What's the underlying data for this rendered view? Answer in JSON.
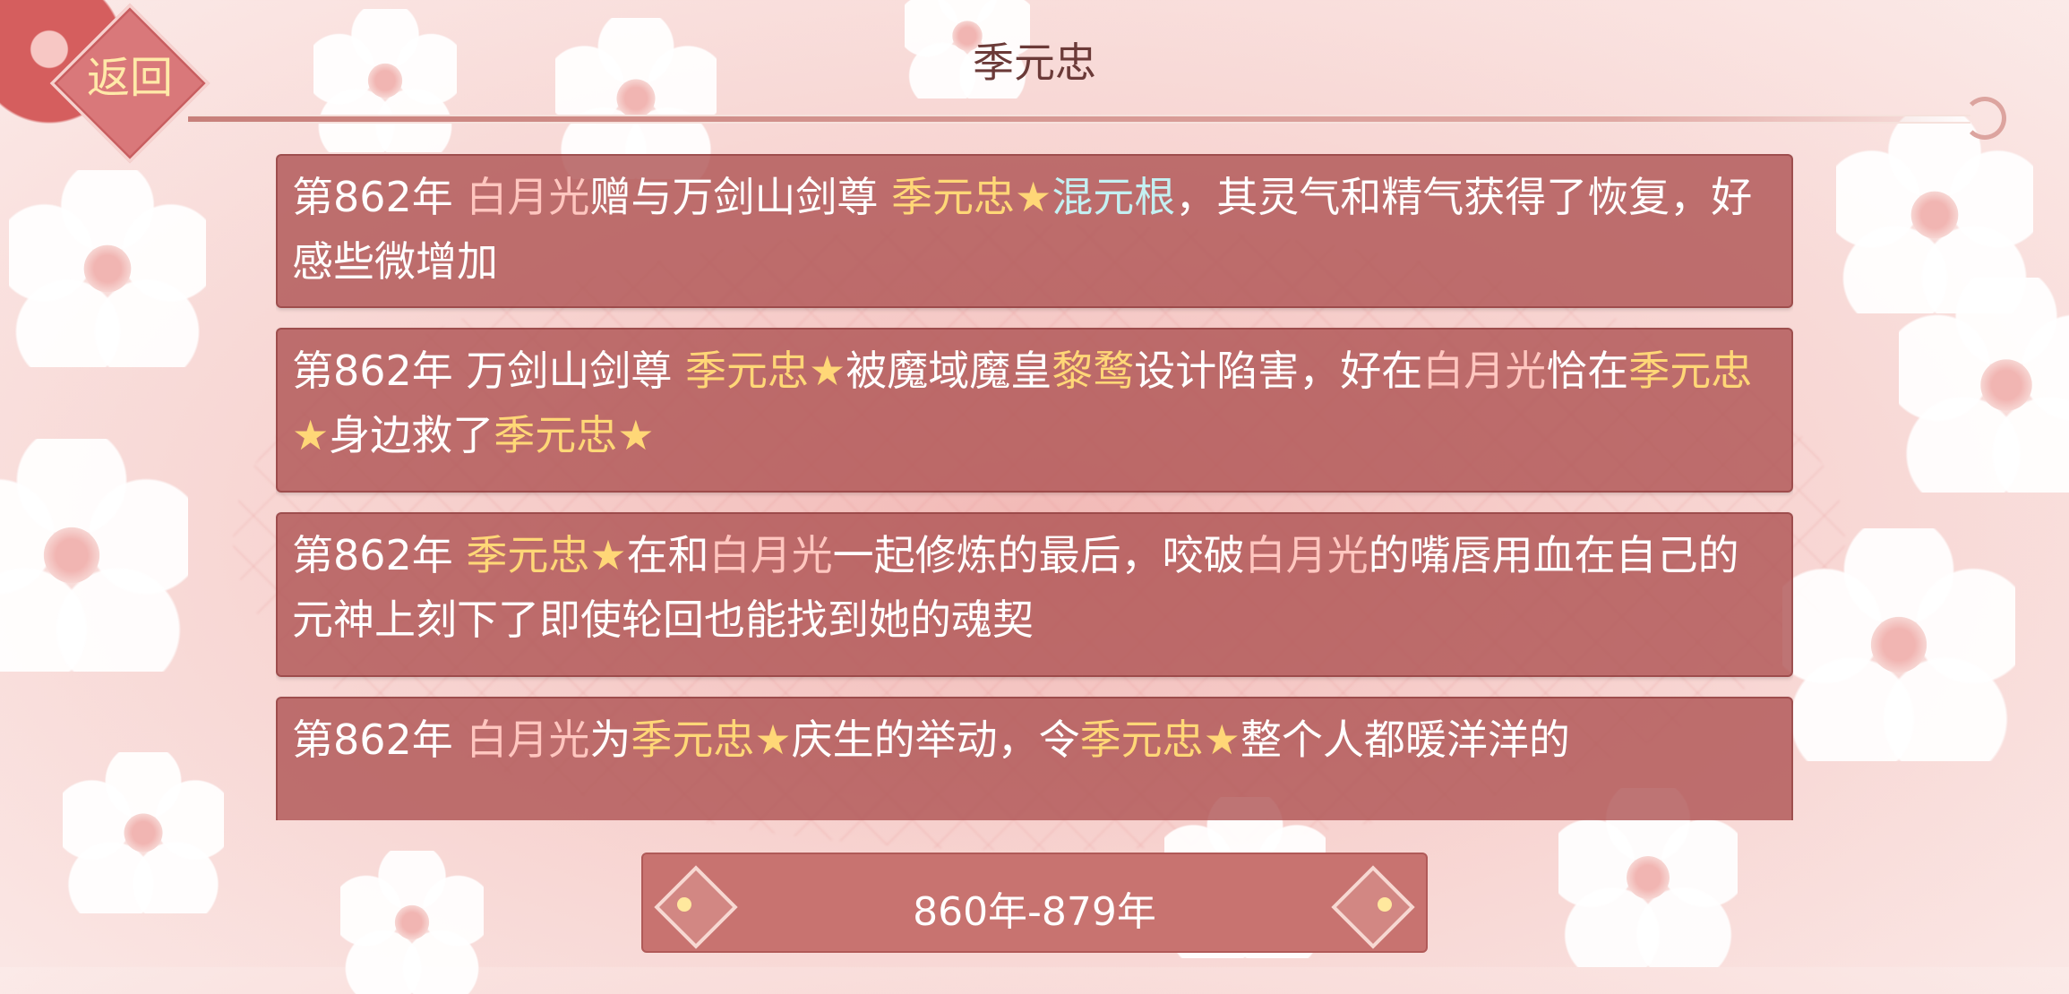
{
  "header": {
    "back_label": "返回",
    "title": "季元忠"
  },
  "entries": [
    {
      "parts": [
        {
          "t": "第862年 ",
          "c": "w"
        },
        {
          "t": "白月光",
          "c": "p"
        },
        {
          "t": "赠与万剑山剑尊 ",
          "c": "w"
        },
        {
          "t": "季元忠★",
          "c": "y"
        },
        {
          "t": "混元根",
          "c": "c"
        },
        {
          "t": "，其灵气和精气获得了恢复，好感些微增加",
          "c": "w"
        }
      ]
    },
    {
      "parts": [
        {
          "t": "第862年 万剑山剑尊 ",
          "c": "w"
        },
        {
          "t": "季元忠★",
          "c": "y"
        },
        {
          "t": "被魔域魔皇",
          "c": "w"
        },
        {
          "t": "黎鹜",
          "c": "y"
        },
        {
          "t": "设计陷害，好在",
          "c": "w"
        },
        {
          "t": "白月光",
          "c": "p"
        },
        {
          "t": "恰在",
          "c": "w"
        },
        {
          "t": "季元忠★",
          "c": "y"
        },
        {
          "t": "身边救了",
          "c": "w"
        },
        {
          "t": "季元忠★",
          "c": "y"
        }
      ]
    },
    {
      "parts": [
        {
          "t": "第862年 ",
          "c": "w"
        },
        {
          "t": "季元忠★",
          "c": "y"
        },
        {
          "t": "在和",
          "c": "w"
        },
        {
          "t": "白月光",
          "c": "p"
        },
        {
          "t": "一起修炼的最后，咬破",
          "c": "w"
        },
        {
          "t": "白月光",
          "c": "p"
        },
        {
          "t": "的嘴唇用血在自己的元神上刻下了即使轮回也能找到她的魂契",
          "c": "w"
        }
      ]
    },
    {
      "parts": [
        {
          "t": "第862年 ",
          "c": "w"
        },
        {
          "t": "白月光",
          "c": "p"
        },
        {
          "t": "为",
          "c": "w"
        },
        {
          "t": "季元忠★",
          "c": "y"
        },
        {
          "t": "庆生的举动，令",
          "c": "w"
        },
        {
          "t": "季元忠★",
          "c": "y"
        },
        {
          "t": "整个人都暖洋洋的",
          "c": "w"
        }
      ]
    }
  ],
  "footer": {
    "range_label": "860年-879年",
    "prev_icon": "ornate-left-arrow-icon",
    "next_icon": "ornate-right-arrow-icon"
  },
  "colors": {
    "highlight_name": "#ffd777",
    "highlight_player": "#ffc6bf",
    "highlight_item": "#c4f0f2",
    "entry_bg": "#b05656"
  }
}
